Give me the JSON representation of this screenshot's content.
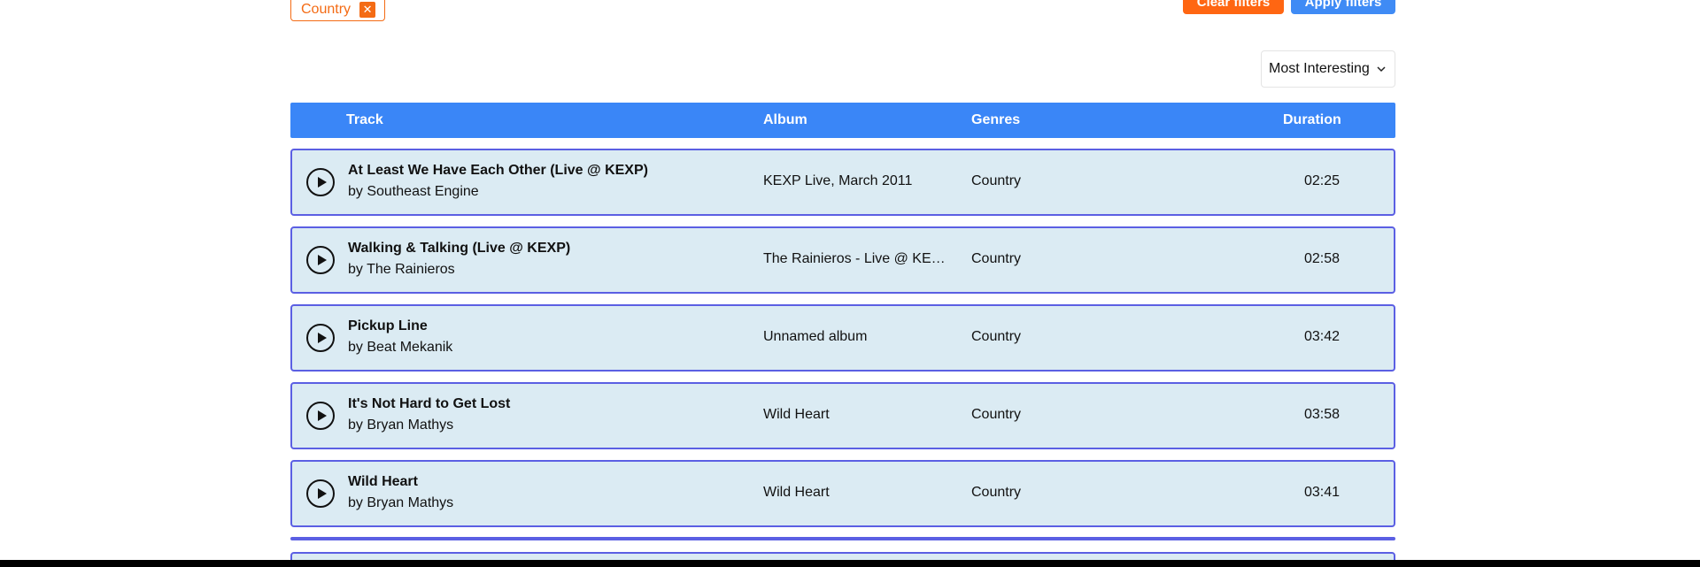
{
  "filters": {
    "active_chip_label": "Country",
    "chip_close_glyph": "✕",
    "clear_label": "Clear filters",
    "apply_label": "Apply filters",
    "clear_color": "#ff6612",
    "apply_color": "#3f8bf5"
  },
  "sort": {
    "selected": "Most Interesting",
    "chevron_icon": "chevron-down-icon"
  },
  "table": {
    "headers": {
      "track": "Track",
      "album": "Album",
      "genres": "Genres",
      "duration": "Duration"
    },
    "header_color": "#3a86f7",
    "row_border_color": "#5b5fe3",
    "row_background": "#dbebf3",
    "rows": [
      {
        "title": "At Least We Have Each Other (Live @ KEXP)",
        "by": "by",
        "artist": "Southeast Engine",
        "album": "KEXP Live, March 2011",
        "genre": "Country",
        "duration": "02:25"
      },
      {
        "title": "Walking & Talking (Live @ KEXP)",
        "by": "by",
        "artist": "The Rainieros",
        "album": "The Rainieros - Live @ KEXP",
        "genre": "Country",
        "duration": "02:58"
      },
      {
        "title": "Pickup Line",
        "by": "by",
        "artist": "Beat Mekanik",
        "album": "Unnamed album",
        "genre": "Country",
        "duration": "03:42"
      },
      {
        "title": "It's Not Hard to Get Lost",
        "by": "by",
        "artist": "Bryan Mathys",
        "album": "Wild Heart",
        "genre": "Country",
        "duration": "03:58"
      },
      {
        "title": "Wild Heart",
        "by": "by",
        "artist": "Bryan Mathys",
        "album": "Wild Heart",
        "genre": "Country",
        "duration": "03:41"
      }
    ]
  }
}
